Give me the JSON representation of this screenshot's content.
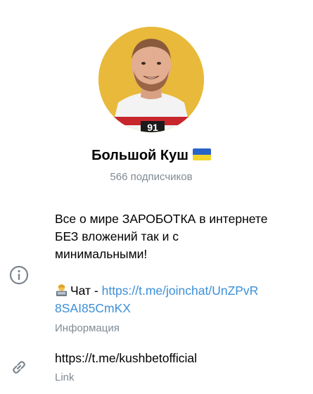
{
  "channel": {
    "name": "Большой Куш",
    "subscribers": "566 подписчиков"
  },
  "description": {
    "lines": [
      "Все о мире ЗАРОБОТКА в интернете",
      "БЕЗ вложений так и с",
      "минимальными!"
    ],
    "chat_prefix": "Чат - ",
    "chat_link_line1": "https://t.me/joinchat/UnZPvR",
    "chat_link_line2": "8SAI85CmKX",
    "label": "Информация"
  },
  "link_field": {
    "value": "https://t.me/kushbetofficial",
    "label": "Link"
  },
  "icons": {
    "info": "info-circle-icon",
    "link": "link-icon",
    "flag": "ukraine-flag-icon",
    "chat_emoji": "technologist-emoji-icon"
  },
  "colors": {
    "link": "#3c8fd8",
    "secondary_text": "#808a93",
    "avatar_background": "#e8b93a",
    "flag_blue": "#2a63c7",
    "flag_yellow": "#f4d32d"
  }
}
